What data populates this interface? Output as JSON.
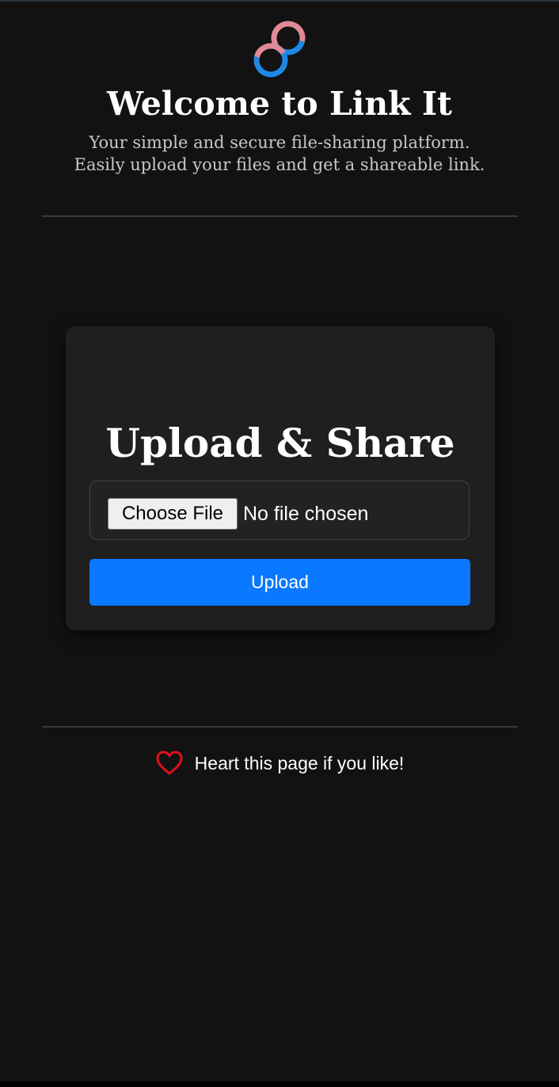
{
  "colors": {
    "background": "#121212",
    "card": "#1f1f1f",
    "accent": "#0a78ff",
    "heart": "#e0111b",
    "logo_blue": "#1e88e5",
    "logo_pink": "#e08a96"
  },
  "header": {
    "logo_icon": "link-chain-icon",
    "title": "Welcome to Link It",
    "subtitle_line1": "Your simple and secure file-sharing platform.",
    "subtitle_line2": "Easily upload your files and get a shareable link."
  },
  "upload_card": {
    "title": "Upload & Share",
    "choose_file_label": "Choose File",
    "file_status": "No file chosen",
    "upload_label": "Upload"
  },
  "footer": {
    "heart_icon": "heart-icon",
    "text": "Heart this page if you like!"
  }
}
